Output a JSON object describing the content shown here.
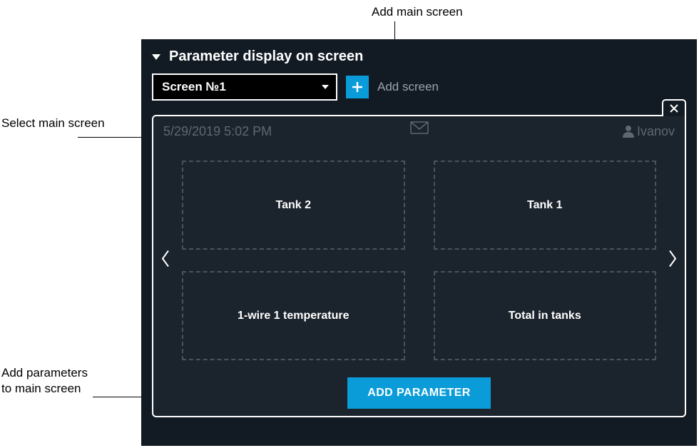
{
  "callouts": {
    "select_main_screen": "Select main screen",
    "add_main_screen": "Add main screen",
    "add_parameters": "Add parameters to main screen"
  },
  "panel": {
    "title": "Parameter display on screen"
  },
  "toolbar": {
    "screen_select_value": "Screen №1",
    "add_screen_label": "Add screen"
  },
  "preview": {
    "status": {
      "datetime": "5/29/2019  5:02 PM",
      "user": "Ivanov"
    },
    "slots": [
      {
        "label": "Tank 2"
      },
      {
        "label": "Tank 1"
      },
      {
        "label": "1-wire 1 temperature"
      },
      {
        "label": "Total in tanks"
      }
    ],
    "add_parameter_label": "ADD PARAMETER"
  }
}
